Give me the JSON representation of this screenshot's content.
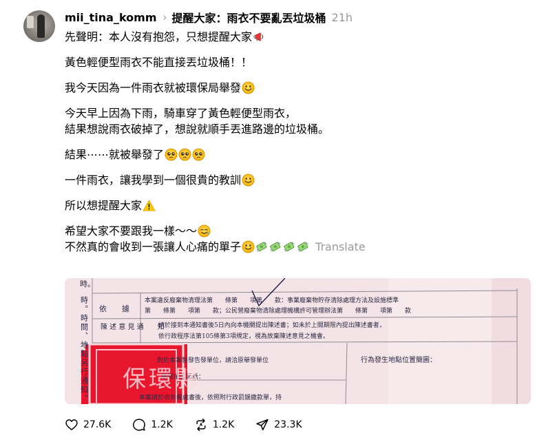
{
  "post": {
    "username": "mii_tina_komm",
    "topic": "提醒大家：雨衣不要亂丟垃圾桶",
    "time": "21h"
  },
  "body": {
    "p1": "先聲明：本人沒有抱怨，只想提醒大家",
    "p2": "黃色輕便型雨衣不能直接丟垃圾桶！！",
    "p3": "我今天因為一件雨衣就被環保局舉發",
    "p4a": "今天早上因為下雨，騎車穿了黃色輕便型雨衣，",
    "p4b": "結果想說雨衣破掉了，想說就順手丟進路邊的垃圾桶。",
    "p5": "結果⋯⋯就被舉發了",
    "p6": "一件雨衣，讓我學到一個很貴的教訓",
    "p7": "所以想提醒大家",
    "p8a": "希望大家不要跟我一樣～～",
    "p8b": "不然真的會收到一張讓人心痛的單子",
    "translate": "Translate"
  },
  "photo": {
    "side_text": "時。時間、地點另行通知。",
    "label_basis": "依　　據",
    "basis_line1": "本案違反廢棄物清理法第　　條第　　項第　　款：事業廢棄物貯存清除處理方法及設施標準",
    "basis_line2": "第　　條第　　項第　　款；公民營廢棄物清除處理機構許可管理辦法第　　條第　　項第　　款",
    "label_opinion": "陳 述 意 見\n通　　知",
    "opinion_line1": "請於接到本通知書後5日內向本機關提出陳述書；如未於上開期限內提出陳述書者，",
    "opinion_line2": "依行政程序法第105條第3項規定，視為放棄陳述意見之機會。",
    "unit_line": "對於本案製發告發單位，請洽原舉發單位",
    "location_label": "行為發生地點位置簡圖：",
    "unit_tel": "舉發單位電話：",
    "bottom_line": "本案請於收到裁處書後，依照附行政罰鍰繳款單，持",
    "stamp_text": "保環縣"
  },
  "actions": {
    "likes": "27.6K",
    "comments": "1.2K",
    "reposts": "1.2K",
    "shares": "23.3K"
  },
  "colors": {
    "text": "#000000",
    "muted": "#999999",
    "stamp_red": "#e8162d",
    "paper": "#f4e3e6"
  }
}
